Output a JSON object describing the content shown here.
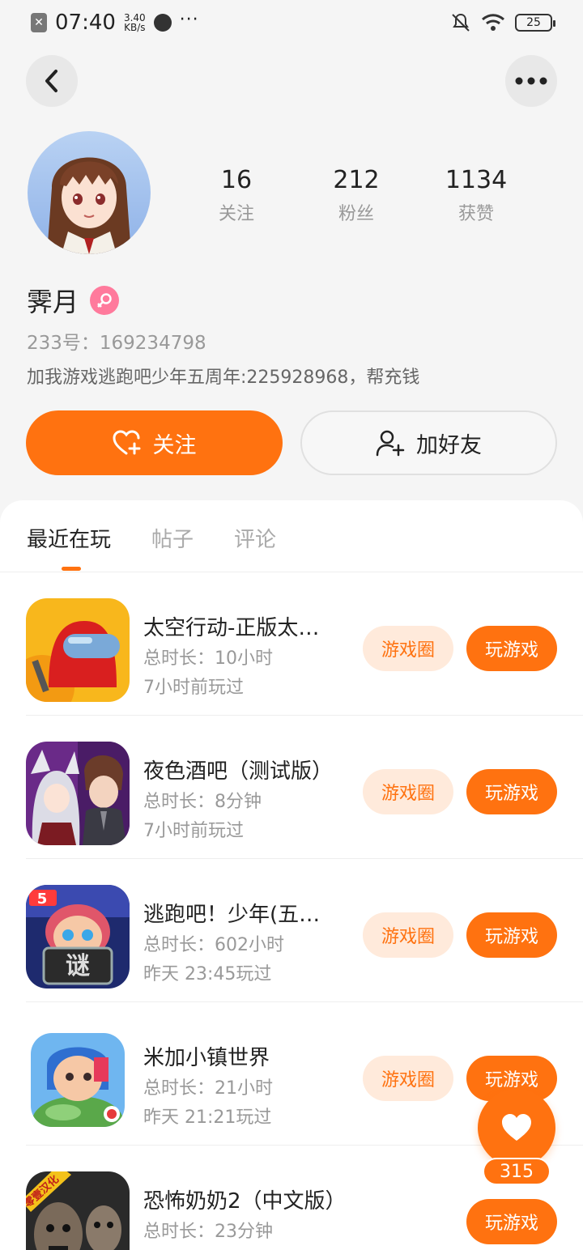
{
  "status_bar": {
    "time": "07:40",
    "speed_value": "3.40",
    "speed_unit": "KB/s",
    "battery": "25"
  },
  "profile": {
    "stats": [
      {
        "value": "16",
        "label": "关注"
      },
      {
        "value": "212",
        "label": "粉丝"
      },
      {
        "value": "1134",
        "label": "获赞"
      }
    ],
    "nickname": "霁月",
    "uid": "233号：169234798",
    "bio": "加我游戏逃跑吧少年五周年:225928968，帮充钱",
    "follow_label": "关注",
    "add_friend_label": "加好友"
  },
  "tabs": [
    {
      "label": "最近在玩"
    },
    {
      "label": "帖子"
    },
    {
      "label": "评论"
    }
  ],
  "games": [
    {
      "title": "太空行动-正版太…",
      "duration": "总时长：10小时",
      "last_played": "7小时前玩过",
      "circle_label": "游戏圈",
      "play_label": "玩游戏"
    },
    {
      "title": "夜色酒吧（测试版）",
      "duration": "总时长：8分钟",
      "last_played": "7小时前玩过",
      "circle_label": "游戏圈",
      "play_label": "玩游戏"
    },
    {
      "title": "逃跑吧！少年(五…",
      "duration": "总时长：602小时",
      "last_played": "昨天 23:45玩过",
      "circle_label": "游戏圈",
      "play_label": "玩游戏"
    },
    {
      "title": "米加小镇世界",
      "duration": "总时长：21小时",
      "last_played": "昨天 21:21玩过",
      "circle_label": "游戏圈",
      "play_label": "玩游戏"
    },
    {
      "title": "恐怖奶奶2（中文版）",
      "duration": "总时长：23分钟",
      "last_played": "",
      "circle_label": "",
      "play_label": "玩游戏"
    }
  ],
  "game_icon_texts": {
    "game3_badge": "5",
    "game5_badge": "零壹汉化"
  },
  "float_like": {
    "count": "315"
  },
  "colors": {
    "accent": "#ff7210",
    "accent_light": "#ffeadb"
  }
}
